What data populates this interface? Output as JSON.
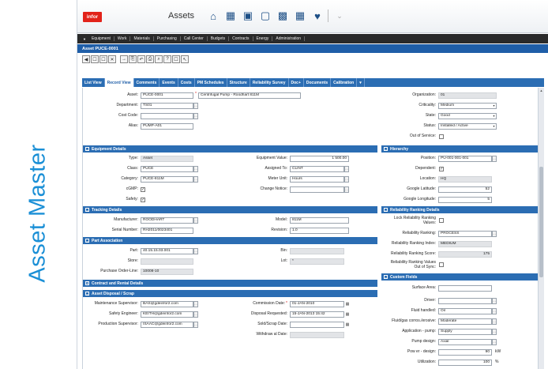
{
  "slide_title": "Asset Master",
  "app": {
    "logo": "infor",
    "module_title": "Assets",
    "top_icons": [
      "home-icon",
      "assets-icon",
      "document-icon",
      "bookmark-icon",
      "report-icon",
      "buildings-icon",
      "favorite-icon",
      "chevron-down-icon"
    ],
    "menu": [
      "Equipment",
      "Work",
      "Materials",
      "Purchasing",
      "Call Center",
      "Budgets",
      "Contracts",
      "Energy",
      "Administration"
    ],
    "asset_header": "Asset PUCE-0001",
    "toolbar_icons": [
      "◀",
      "☐",
      "☐",
      "✕",
      "→",
      "⎘",
      "↶",
      "⎙",
      "⌕",
      "?",
      "☐",
      "↖"
    ],
    "tabs": [
      "List View",
      "Record View",
      "Comments",
      "Events",
      "Costs",
      "PM Schedules",
      "Structure",
      "Reliability Survey",
      "Doc+",
      "Documents",
      "Calibration",
      "▾"
    ],
    "active_tab_index": 1
  },
  "header_fields": {
    "asset_label": "Asset:",
    "asset_code": "PUCE-0001",
    "asset_desc": "Centrifugal Pump - Roodhart 811M",
    "department_label": "Department:",
    "department": "TS01",
    "cost_code_label": "Cost Code:",
    "cost_code": "",
    "alias_label": "Alias:",
    "alias": "PUMP-A01",
    "organization_label": "Organization:",
    "organization": "01",
    "criticality_label": "Criticality:",
    "criticality": "Medium",
    "state_label": "State:",
    "state": "Good",
    "status_label": "Status:",
    "status": "Installed / Active",
    "out_of_service_label": "Out of Service:"
  },
  "equipment_details": {
    "title": "Equipment Details",
    "type_label": "Type:",
    "type": "Asset",
    "class_label": "Class:",
    "class": "PUCE",
    "category_label": "Category:",
    "category": "PUCE-811M",
    "cgmp_label": "cGMP:",
    "safety_label": "Safety:",
    "equipment_value_label": "Equipment Value:",
    "equipment_value": "1 500.00",
    "assigned_to_label": "Assigned To:",
    "assigned_to": "CLINT",
    "meter_unit_label": "Meter Unit:",
    "meter_unit": "Hours",
    "change_notice_label": "Change Notice:",
    "change_notice": ""
  },
  "hierarchy": {
    "title": "Hierarchy",
    "position_label": "Position:",
    "position": "PU-001-001-001",
    "dependent_label": "Dependent:",
    "location_label": "Location:",
    "location": "HQ",
    "latitude_label": "Google Latitude:",
    "latitude": "52",
    "longitude_label": "Google Longitude:",
    "longitude": "5"
  },
  "tracking": {
    "title": "Tracking Details",
    "manufacturer_label": "Manufacturer:",
    "manufacturer": "ROODHART",
    "serial_label": "Serial Number:",
    "serial": "RH2011/0023401",
    "model_label": "Model:",
    "model": "811M",
    "revision_label": "Revision:",
    "revision": "1.0"
  },
  "reliability": {
    "title": "Reliability Ranking Details",
    "lock_label": "Lock Reliability Ranking Values:",
    "ranking_label": "Reliability Ranking:",
    "ranking": "PROCESS",
    "index_label": "Reliability Ranking Index:",
    "index": "MEDIUM",
    "score_label": "Reliability Ranking Score:",
    "score": "175",
    "out_of_sync_label": "Reliability Ranking Values Out of Sync:"
  },
  "part_association": {
    "title": "Part Association",
    "part_label": "Part:",
    "part": "40.15.15.03.001",
    "store_label": "Store:",
    "store": "",
    "pol_label": "Purchase Order-Line:",
    "pol": "10008-10",
    "bin_label": "Bin:",
    "bin": "",
    "lot_label": "Lot:",
    "lot": "*"
  },
  "contract": {
    "title": "Contract and Rental Details"
  },
  "disposal": {
    "title": "Asset Disposal / Scrap",
    "maint_label": "Maintenance Supervisor:",
    "maint": "BAS@gdeinfor2.com",
    "safety_eng_label": "Safety Engineer:",
    "safety_eng": "KEITH@gdeinfor2.com",
    "prod_label": "Production Supervisor:",
    "prod": "ISAAC@gdeinfor2.com",
    "commission_label": "Commission Date:",
    "commission": "01-JAN-2010",
    "disposal_req_label": "Disposal Requested:",
    "disposal_req": "15-JAN-2013 15:42",
    "sold_label": "Sold/Scrap Date:",
    "sold": "",
    "withdraw_label": "Withdraw al Date:"
  },
  "custom_fields": {
    "title": "Custom Fields",
    "surface_label": "Surface Area:",
    "surface": "",
    "driver_label": "Driver:",
    "driver": "",
    "fluid_label": "Fluid handled:",
    "fluid": "Oil",
    "fluid_corr_label": "Fluid/gas corros./erosive:",
    "fluid_corr": "Moderate",
    "application_label": "Application - pump:",
    "application": "Supply",
    "pump_design_label": "Pump design:",
    "pump_design": "Axial",
    "power_label": "Pow er - design:",
    "power": "90",
    "power_unit": "kW",
    "util_label": "Utilization:",
    "util": "100",
    "util_unit": "%"
  },
  "checks": {
    "cgmp": true,
    "safety": true,
    "dependent": true,
    "out_of_service": false,
    "lock": false,
    "out_of_sync": false
  }
}
